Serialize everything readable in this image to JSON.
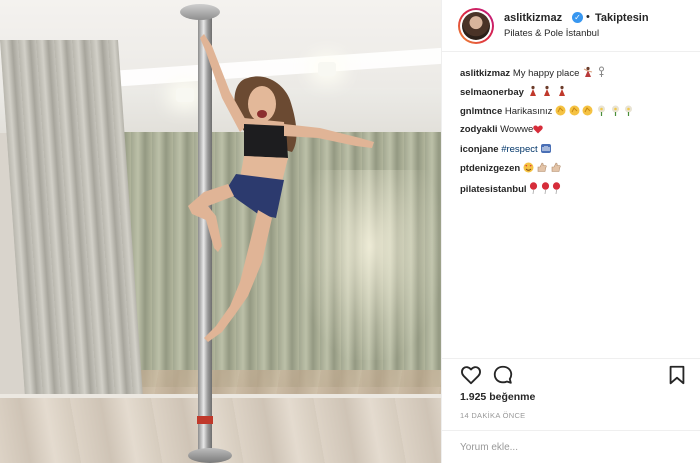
{
  "post": {
    "username": "aslitkizmaz",
    "verified_icon": "verified-badge-icon",
    "separator": "•",
    "follow_status": "Takiptesin",
    "location": "Pilates & Pole İstanbul"
  },
  "comments": [
    {
      "author": "aslitkizmaz",
      "text": "My happy place",
      "emoji": [
        "dancer-emoji",
        "woman-emoji"
      ]
    },
    {
      "author": "selmaonerbay",
      "text": "",
      "emoji": [
        "dancer-emoji",
        "dancer-emoji",
        "dancer-emoji"
      ]
    },
    {
      "author": "gnlmtnce",
      "text": "Harikasınız",
      "emoji": [
        "clap-emoji",
        "clap-emoji",
        "clap-emoji",
        "flower-emoji",
        "flower-emoji",
        "flower-emoji"
      ]
    },
    {
      "author": "zodyakli",
      "text": "Wowwe",
      "emoji": [
        "heart-emoji"
      ]
    },
    {
      "author": "iconjane",
      "text": "#respect",
      "emoji": [
        "raised-hands-emoji"
      ]
    },
    {
      "author": "ptdenizgezen",
      "text": "",
      "emoji": [
        "heart-eyes-emoji",
        "thumbs-up-emoji",
        "thumbs-up-emoji"
      ]
    },
    {
      "author": "pilatesistanbul",
      "text": "",
      "emoji": [
        "balloon-emoji",
        "balloon-emoji",
        "balloon-emoji"
      ]
    }
  ],
  "actions": {
    "like_icon": "heart-outline-icon",
    "comment_icon": "comment-bubble-icon",
    "save_icon": "bookmark-icon"
  },
  "likes_text": "1.925 beğenme",
  "time_text": "14 DAKİKA ÖNCE",
  "comment_placeholder": "Yorum ekle...",
  "colors": {
    "verified": "#3897f0",
    "hashtag": "#003569",
    "muted": "#999999",
    "text": "#262626"
  }
}
